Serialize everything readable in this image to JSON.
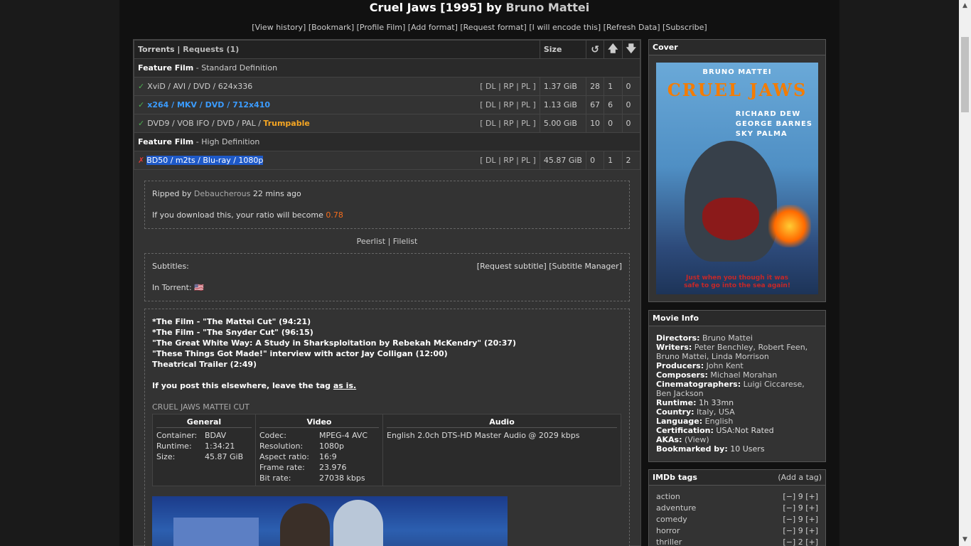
{
  "header": {
    "title": "Cruel Jaws [1995] by ",
    "director": "Bruno Mattei",
    "links": [
      "[View history]",
      "[Bookmark]",
      "[Profile Film]",
      "[Add format]",
      "[Request format]",
      "[I will encode this]",
      "[Refresh Data]",
      "[Subscribe]"
    ]
  },
  "torrents": {
    "tab_torrents": "Torrents",
    "separator": "|",
    "tab_requests": "Requests (1)",
    "col_size": "Size",
    "col_snatched_icon": "↺",
    "col_seeders_icon": "🡅",
    "col_leechers_icon": "🡇",
    "section_sd": "Feature Film",
    "section_sd_sub": " - Standard Definition",
    "section_hd": "Feature Film",
    "section_hd_sub": " - High Definition",
    "dl_links": "[ DL | RP | PL ]",
    "rows": [
      {
        "name": "XviD / AVI / DVD / 624x336",
        "size": "1.37 GiB",
        "snatched": "28",
        "seeders": "1",
        "leechers": "0"
      },
      {
        "name": "x264 / MKV / DVD / 712x410",
        "size": "1.13 GiB",
        "snatched": "67",
        "seeders": "6",
        "leechers": "0"
      },
      {
        "name": "DVD9 / VOB IFO / DVD / PAL / ",
        "trump": "Trumpable",
        "size": "5.00 GiB",
        "snatched": "10",
        "seeders": "0",
        "leechers": "0"
      },
      {
        "name": "BD50 / m2ts / Blu-ray / 1080p",
        "size": "45.87 GiB",
        "snatched": "0",
        "seeders": "1",
        "leechers": "2"
      }
    ]
  },
  "details": {
    "ripped_by_label": "Ripped by ",
    "ripper": "Debaucherous",
    "ripped_time": " 22 mins ago",
    "ratio_text": "If you download this, your ratio will become ",
    "ratio_value": "0.78",
    "peerlist": "Peerlist",
    "filelist": "Filelist",
    "subtitles_label": "Subtitles:",
    "request_subtitle": "[Request subtitle]",
    "subtitle_manager": "[Subtitle Manager]",
    "in_torrent": "In Torrent:",
    "flag": "🇺🇸"
  },
  "description": {
    "lines": [
      "*The Film - \"The Mattei Cut\" (94:21)",
      "*The Film - \"The Snyder Cut\" (96:15)",
      "\"The Great White Way: A Study in Sharksploitation by Rebekah McKendry\" (20:37)",
      "\"These Things Got Made!\" interview with actor Jay Colligan (12:00)",
      "Theatrical Trailer (2:49)"
    ],
    "tag_note": "If you post this elsewhere, leave the tag ",
    "tag_note_link": "as is.",
    "mediainfo_title": "CRUEL JAWS MATTEI CUT",
    "general_header": "General",
    "video_header": "Video",
    "audio_header": "Audio",
    "general": [
      {
        "k": "Container:",
        "v": "BDAV"
      },
      {
        "k": "Runtime:",
        "v": "1:34:21"
      },
      {
        "k": "Size:",
        "v": "45.87 GiB"
      }
    ],
    "video": [
      {
        "k": "Codec:",
        "v": "MPEG-4 AVC"
      },
      {
        "k": "Resolution:",
        "v": "1080p"
      },
      {
        "k": "Aspect ratio:",
        "v": "16:9"
      },
      {
        "k": "Frame rate:",
        "v": "23.976"
      },
      {
        "k": "Bit rate:",
        "v": "27038 kbps"
      }
    ],
    "audio": "English 2.0ch DTS-HD Master Audio @ 2029 kbps"
  },
  "cover": {
    "header": "Cover",
    "poster_director": "BRUNO MATTEI",
    "poster_title": "CRUEL JAWS",
    "poster_cast": [
      "RICHARD DEW",
      "GEORGE BARNES",
      "SKY PALMA"
    ],
    "poster_tagline_1": "Just when you though it was",
    "poster_tagline_2": "safe to go into the sea again!"
  },
  "movie_info": {
    "header": "Movie Info",
    "directors_label": "Directors:",
    "directors": "Bruno Mattei",
    "writers_label": "Writers:",
    "writers": "Peter Benchley, Robert Feen, Bruno Mattei, Linda Morrison",
    "producers_label": "Producers:",
    "producers": "John Kent",
    "composers_label": "Composers:",
    "composers": "Michael Morahan",
    "cinematographers_label": "Cinematographers:",
    "cinematographers": "Luigi Ciccarese, Ben Jackson",
    "runtime_label": "Runtime:",
    "runtime": "1h 33mn",
    "country_label": "Country:",
    "country": "Italy, USA",
    "language_label": "Language:",
    "language": "English",
    "certification_label": "Certification:",
    "certification": "USA:Not Rated",
    "akas_label": "AKAs:",
    "akas": "(View)",
    "bookmarked_label": "Bookmarked by:",
    "bookmarked": "10 Users"
  },
  "imdb_tags": {
    "header": "IMDb tags",
    "add": "(Add a tag)",
    "tags": [
      {
        "name": "action",
        "votes": "[−] 9 [+]"
      },
      {
        "name": "adventure",
        "votes": "[−] 9 [+]"
      },
      {
        "name": "comedy",
        "votes": "[−] 9 [+]"
      },
      {
        "name": "horror",
        "votes": "[−] 9 [+]"
      },
      {
        "name": "thriller",
        "votes": "[−] 2 [+]"
      }
    ]
  }
}
